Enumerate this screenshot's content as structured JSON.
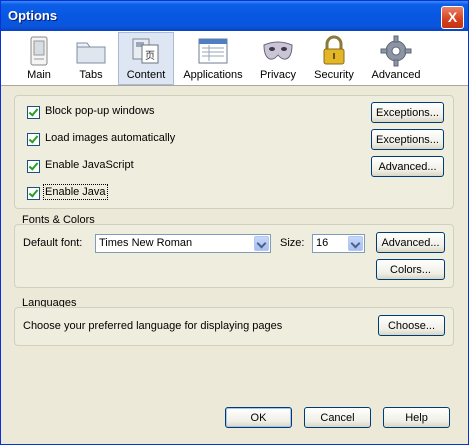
{
  "window": {
    "title": "Options",
    "close_label": "X"
  },
  "toolbar": {
    "items": [
      {
        "label": "Main"
      },
      {
        "label": "Tabs"
      },
      {
        "label": "Content"
      },
      {
        "label": "Applications"
      },
      {
        "label": "Privacy"
      },
      {
        "label": "Security"
      },
      {
        "label": "Advanced"
      }
    ],
    "active": "Content"
  },
  "content": {
    "checkboxes": [
      {
        "label": "Block pop-up windows",
        "checked": true
      },
      {
        "label": "Load images automatically",
        "checked": true
      },
      {
        "label": "Enable JavaScript",
        "checked": true
      },
      {
        "label": "Enable Java",
        "checked": true
      }
    ],
    "buttons": {
      "popup_exceptions": "Exceptions...",
      "images_exceptions": "Exceptions...",
      "js_advanced": "Advanced..."
    }
  },
  "fonts": {
    "title": "Fonts & Colors",
    "default_font_label": "Default font:",
    "default_font_value": "Times New Roman",
    "size_label": "Size:",
    "size_value": "16",
    "advanced_button": "Advanced...",
    "colors_button": "Colors..."
  },
  "languages": {
    "title": "Languages",
    "description": "Choose your preferred language for displaying pages",
    "choose_button": "Choose..."
  },
  "footer": {
    "ok": "OK",
    "cancel": "Cancel",
    "help": "Help"
  }
}
